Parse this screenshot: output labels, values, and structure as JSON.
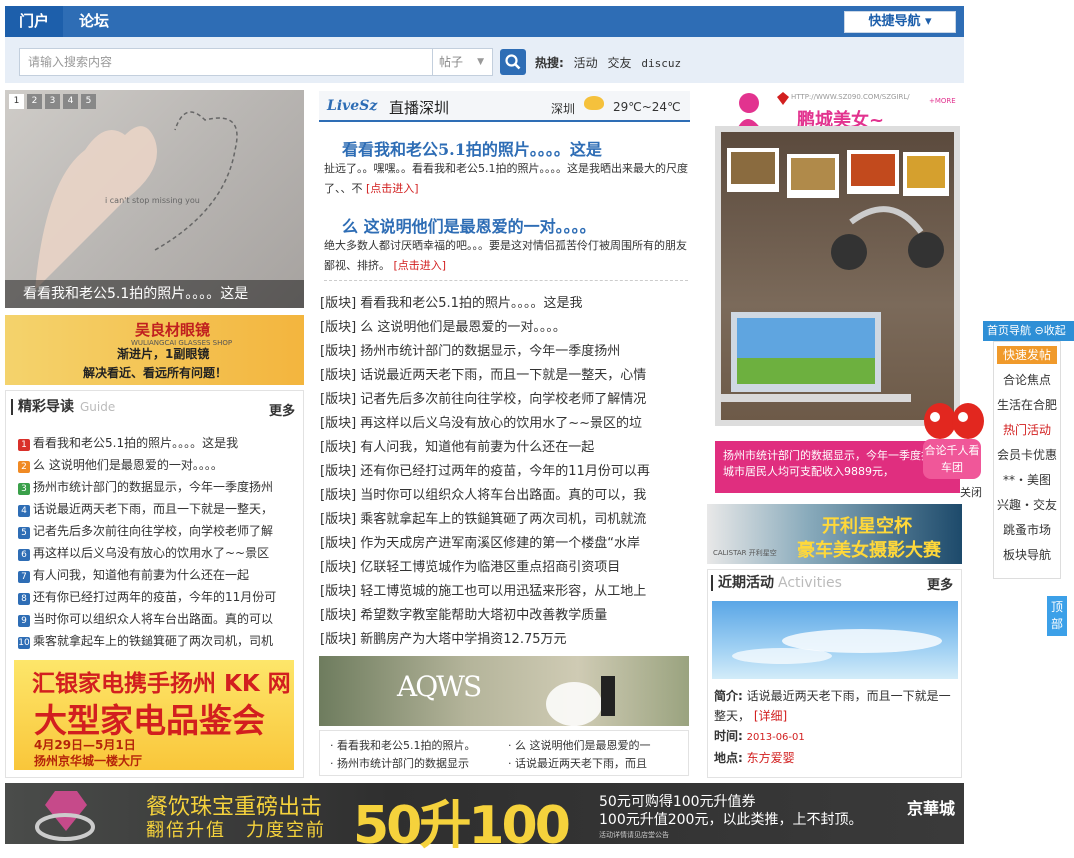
{
  "nav": {
    "tabs": [
      "门户",
      "论坛"
    ],
    "quick_nav": "快捷导航 ▾"
  },
  "search": {
    "placeholder": "请输入搜索内容",
    "type": "帖子",
    "hot_label": "热搜:",
    "hot": [
      "活动",
      "交友",
      "discuz"
    ]
  },
  "slide": {
    "nums": [
      "1",
      "2",
      "3",
      "4",
      "5"
    ],
    "caption": "看看我和老公5.1拍的照片。。。。这是",
    "img_text": "i can't stop missing you"
  },
  "ad_glasses": {
    "brand": "吴良材眼镜",
    "sub": "WULIANGCAI GLASSES SHOP",
    "line1": "渐进片，1副眼镜",
    "line2": "解决看近、看远所有问题！"
  },
  "guide": {
    "title": "精彩导读",
    "en": "Guide",
    "more": "更多",
    "items": [
      "看看我和老公5.1拍的照片。。。。这是我",
      "么 这说明他们是最恩爱的一对。。。。",
      "扬州市统计部门的数据显示，今年一季度扬州",
      "话说最近两天老下雨，而且一下就是一整天，",
      "记者先后多次前往向往学校，向学校老师了解",
      "再这样以后义乌没有放心的饮用水了~~景区",
      "有人问我，知道他有前妻为什么还在一起",
      "还有你已经打过两年的疫苗，今年的11月份可",
      "当时你可以组织众人将车台出路面。真的可以",
      "乘客就拿起车上的铁鎚箕砸了两次司机，司机"
    ],
    "num_colors": [
      "#d9302a",
      "#f08a24",
      "#3aa04a",
      "#2e6db5",
      "#2e6db5",
      "#2e6db5",
      "#2e6db5",
      "#2e6db5",
      "#2e6db5",
      "#2e6db5"
    ]
  },
  "ad_kk": {
    "a": "汇银家电携手扬州 KK 网",
    "b": "大型家电品鉴会",
    "c": "4月29日—5月1日",
    "d": "扬州京华城一楼大厅"
  },
  "live": {
    "logo": "LiveSz",
    "title": "直播深圳",
    "city": "深圳",
    "temp": "29℃~24℃"
  },
  "headlines": [
    {
      "title": "看看我和老公5.1拍的照片。。。。这是",
      "summary": "扯远了。。嘿嘿。。看看我和老公5.1拍的照片。。。。这是我晒出来最大的尺度了、、不",
      "enter": "[点击进入]"
    },
    {
      "title": "么 这说明他们是最恩爱的一对。。。。",
      "summary": "绝大多数人都讨厌晒幸福的吧。。。要是这对情侣孤苦伶仃被周围所有的朋友鄙视、排挤。",
      "enter": "[点击进入]"
    }
  ],
  "boards": [
    "[版块] 看看我和老公5.1拍的照片。。。。这是我",
    "[版块] 么 这说明他们是最恩爱的一对。。。。",
    "[版块] 扬州市统计部门的数据显示，今年一季度扬州",
    "[版块] 话说最近两天老下雨，而且一下就是一整天，心情",
    "[版块] 记者先后多次前往向往学校，向学校老师了解情况",
    "[版块] 再这样以后义乌没有放心的饮用水了~~景区的垃",
    "[版块] 有人问我，知道他有前妻为什么还在一起",
    "[版块] 还有你已经打过两年的疫苗，今年的11月份可以再",
    "[版块] 当时你可以组织众人将车台出路面。真的可以，我",
    "[版块] 乘客就拿起车上的铁鎚箕砸了两次司机，司机就流",
    "[版块] 作为天成房产进军南溪区修建的第一个楼盘“水岸",
    "[版块] 亿联轻工博览城作为临港区重点招商引资项目",
    "[版块] 轻工博览城的施工也可以用迅猛来形容，从工地上",
    "[版块] 希望数字教室能帮助大塔初中改善教学质量",
    "[版块] 新鹏房产为大塔中学捐资12.75万元"
  ],
  "wedding": {
    "logo": "AQWS",
    "links": [
      "· 看看我和老公5.1拍的照片。",
      "· 么 这说明他们是最恩爱的一",
      "· 扬州市统计部门的数据显示",
      "· 话说最近两天老下雨，而且"
    ]
  },
  "right_ad": {
    "brand": "鹏城美女~",
    "url": "HTTP://WWW.SZ090.COM/SZGIRL/",
    "more": "+MORE",
    "caption": "扬州市统计部门的数据显示，今年一季度扬州城市居民人均可支配收入9889元，"
  },
  "mascot": {
    "bubble": "合论千人看车团",
    "close": "关闭"
  },
  "ad_car": {
    "t1": "开利星空杯",
    "t2": "豪车美女摄影大赛",
    "logo": "CALISTAR 开利星空"
  },
  "activity": {
    "title": "近期活动",
    "en": "Activities",
    "more": "更多",
    "intro_label": "简介:",
    "intro": "话说最近两天老下雨，而且一下就是一整天，",
    "detail": "[详细]",
    "time_label": "时间:",
    "time": "2013-06-01",
    "place_label": "地点:",
    "place": "东方爱婴"
  },
  "sidenav": {
    "top": "首页导航 ⊖收起",
    "post": "快速发帖",
    "items": [
      "合论焦点",
      "生活在合肥",
      "热门活动",
      "会员卡优惠",
      "**・美图",
      "兴趣・交友",
      "跳蚤市场",
      "板块导航"
    ],
    "to_top": "顶部"
  },
  "bottom_ad": {
    "t1": "餐饮珠宝重磅出击",
    "t2": "翻倍升值　力度空前",
    "big": "50升100",
    "r1": "50元可购得100元升值券",
    "r2": "100元升值200元，以此类推，上不封顶。",
    "r3": "活动详情请见店堂公告",
    "brand": "京華城"
  }
}
